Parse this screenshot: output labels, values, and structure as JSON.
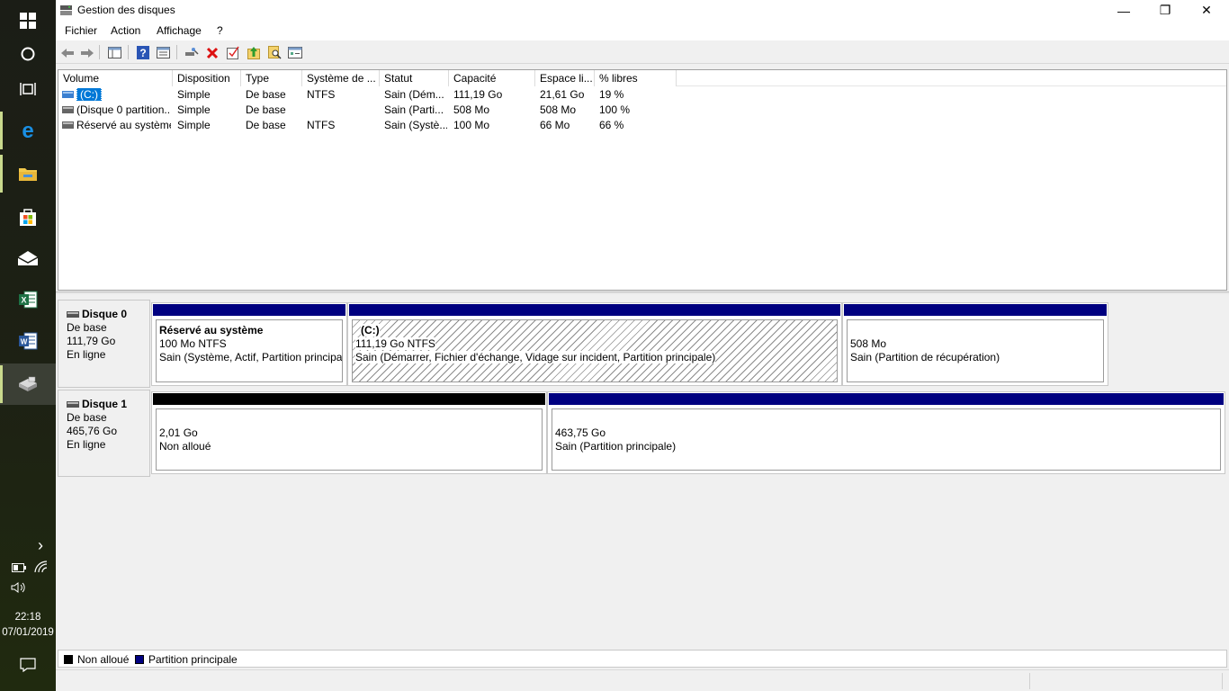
{
  "window": {
    "title": "Gestion des disques",
    "minimize": "—",
    "restore": "❐",
    "close": "✕"
  },
  "menu": {
    "items": [
      "Fichier",
      "Action",
      "Affichage",
      "?"
    ]
  },
  "volume_list": {
    "columns": [
      "Volume",
      "Disposition",
      "Type",
      "Système de ...",
      "Statut",
      "Capacité",
      "Espace li...",
      "% libres"
    ],
    "rows": [
      {
        "volume": "(C:)",
        "disposition": "Simple",
        "type": "De base",
        "fs": "NTFS",
        "status": "Sain (Dém...",
        "capacity": "111,19 Go",
        "free": "21,61 Go",
        "pct": "19 %",
        "selected": true
      },
      {
        "volume": "(Disque 0 partition...",
        "disposition": "Simple",
        "type": "De base",
        "fs": "",
        "status": "Sain (Parti...",
        "capacity": "508 Mo",
        "free": "508 Mo",
        "pct": "100 %",
        "selected": false
      },
      {
        "volume": "Réservé au système",
        "disposition": "Simple",
        "type": "De base",
        "fs": "NTFS",
        "status": "Sain (Systè...",
        "capacity": "100 Mo",
        "free": "66 Mo",
        "pct": "66 %",
        "selected": false
      }
    ]
  },
  "disks": [
    {
      "name": "Disque 0",
      "type": "De base",
      "size": "111,79 Go",
      "state": "En ligne",
      "partitions": [
        {
          "title": "Réservé au système",
          "line1": "100 Mo NTFS",
          "line2": "Sain (Système, Actif, Partition principa",
          "color": "#000080",
          "hatched": false
        },
        {
          "title": "(C:)",
          "line1": "111,19 Go NTFS",
          "line2": "Sain (Démarrer, Fichier d'échange, Vidage sur incident, Partition principale)",
          "color": "#000080",
          "hatched": true
        },
        {
          "title": "",
          "line1": "508 Mo",
          "line2": "Sain (Partition de récupération)",
          "color": "#000080",
          "hatched": false
        }
      ]
    },
    {
      "name": "Disque 1",
      "type": "De base",
      "size": "465,76 Go",
      "state": "En ligne",
      "partitions": [
        {
          "title": "",
          "line1": "2,01 Go",
          "line2": "Non alloué",
          "color": "#000000",
          "hatched": false
        },
        {
          "title": "",
          "line1": "463,75 Go",
          "line2": "Sain (Partition principale)",
          "color": "#000080",
          "hatched": false
        }
      ]
    }
  ],
  "legend": [
    {
      "label": "Non alloué",
      "color": "#000000"
    },
    {
      "label": "Partition principale",
      "color": "#000080"
    }
  ],
  "taskbar": {
    "chevron": "›",
    "time": "22:18",
    "date": "07/01/2019"
  },
  "icons": [
    "windows-start-icon",
    "cortana-icon",
    "task-view-icon",
    "edge-icon",
    "file-explorer-icon",
    "store-icon",
    "mail-icon",
    "excel-icon",
    "word-icon",
    "disk-management-icon",
    "battery-icon",
    "wifi-icon",
    "volume-icon",
    "action-center-icon"
  ]
}
